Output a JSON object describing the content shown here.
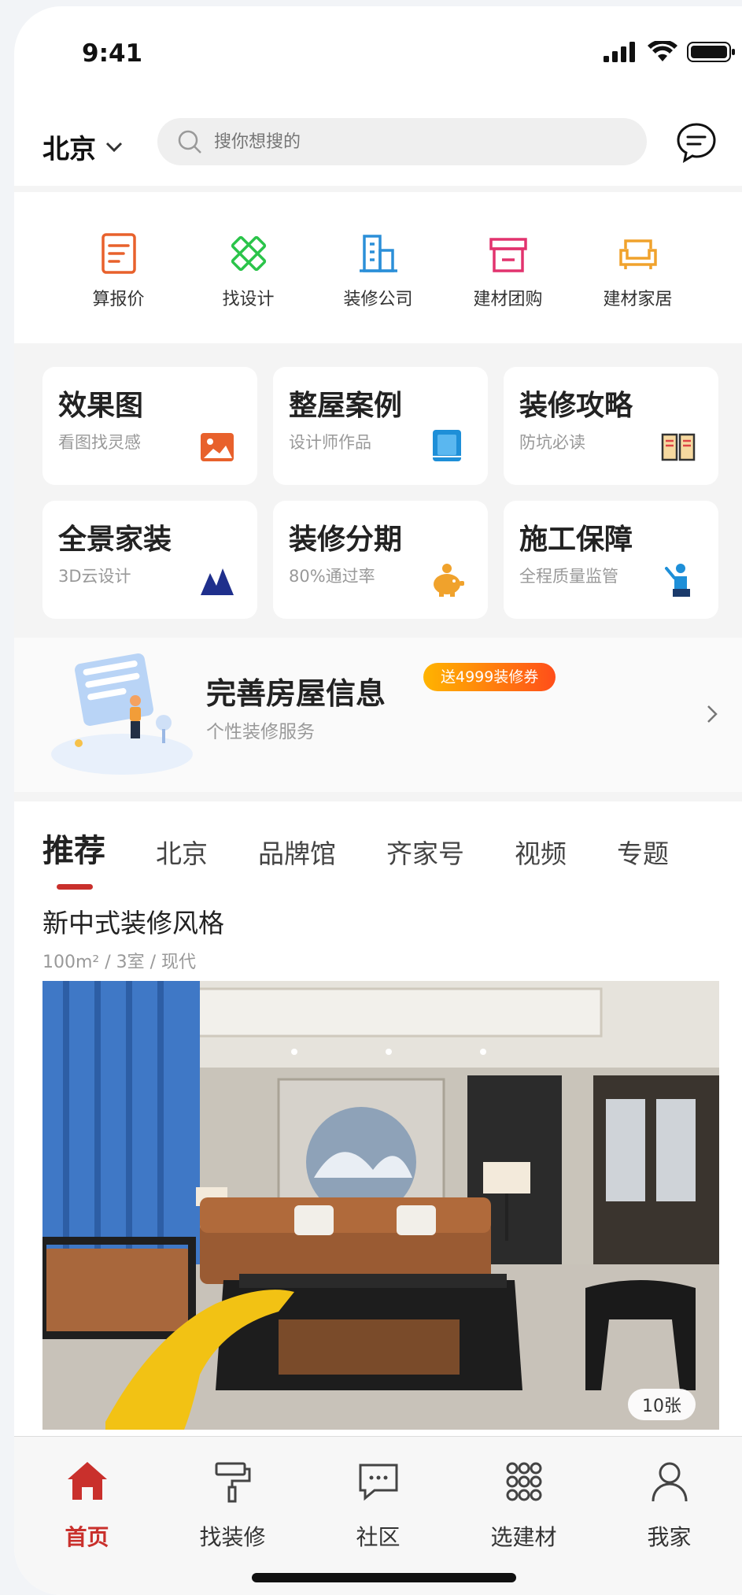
{
  "status": {
    "time": "9:41"
  },
  "header": {
    "city": "北京",
    "search_placeholder": "搜你想搜的"
  },
  "shortcuts": [
    {
      "label": "算报价",
      "icon": "quote-doc-icon",
      "color": "#e8612c"
    },
    {
      "label": "找设计",
      "icon": "pencil-ruler-icon",
      "color": "#2bc44a"
    },
    {
      "label": "装修公司",
      "icon": "building-icon",
      "color": "#2b8fd8"
    },
    {
      "label": "建材团购",
      "icon": "store-icon",
      "color": "#e2336e"
    },
    {
      "label": "建材家居",
      "icon": "sofa-icon",
      "color": "#f0a22c"
    }
  ],
  "features": [
    {
      "title": "效果图",
      "subtitle": "看图找灵感",
      "icon": "image-icon"
    },
    {
      "title": "整屋案例",
      "subtitle": "设计师作品",
      "icon": "book-icon"
    },
    {
      "title": "装修攻略",
      "subtitle": "防坑必读",
      "icon": "open-book-icon"
    },
    {
      "title": "全景家装",
      "subtitle": "3D云设计",
      "icon": "mountain-icon"
    },
    {
      "title": "装修分期",
      "subtitle": "80%通过率",
      "icon": "piggy-bank-icon"
    },
    {
      "title": "施工保障",
      "subtitle": "全程质量监管",
      "icon": "worker-icon"
    }
  ],
  "banner": {
    "title": "完善房屋信息",
    "subtitle": "个性装修服务",
    "badge": "送4999装修券"
  },
  "tabs": [
    "推荐",
    "北京",
    "品牌馆",
    "齐家号",
    "视频",
    "专题"
  ],
  "active_tab": "推荐",
  "post": {
    "title": "新中式装修风格",
    "meta": "100m² / 3室 / 现代",
    "photo_count": "10张"
  },
  "nav": [
    {
      "label": "首页",
      "icon": "home-icon",
      "active": true
    },
    {
      "label": "找装修",
      "icon": "paint-roller-icon",
      "active": false
    },
    {
      "label": "社区",
      "icon": "chat-bubble-icon",
      "active": false
    },
    {
      "label": "选建材",
      "icon": "grid-dots-icon",
      "active": false
    },
    {
      "label": "我家",
      "icon": "person-icon",
      "active": false
    }
  ],
  "colors": {
    "accent": "#c9302c"
  }
}
